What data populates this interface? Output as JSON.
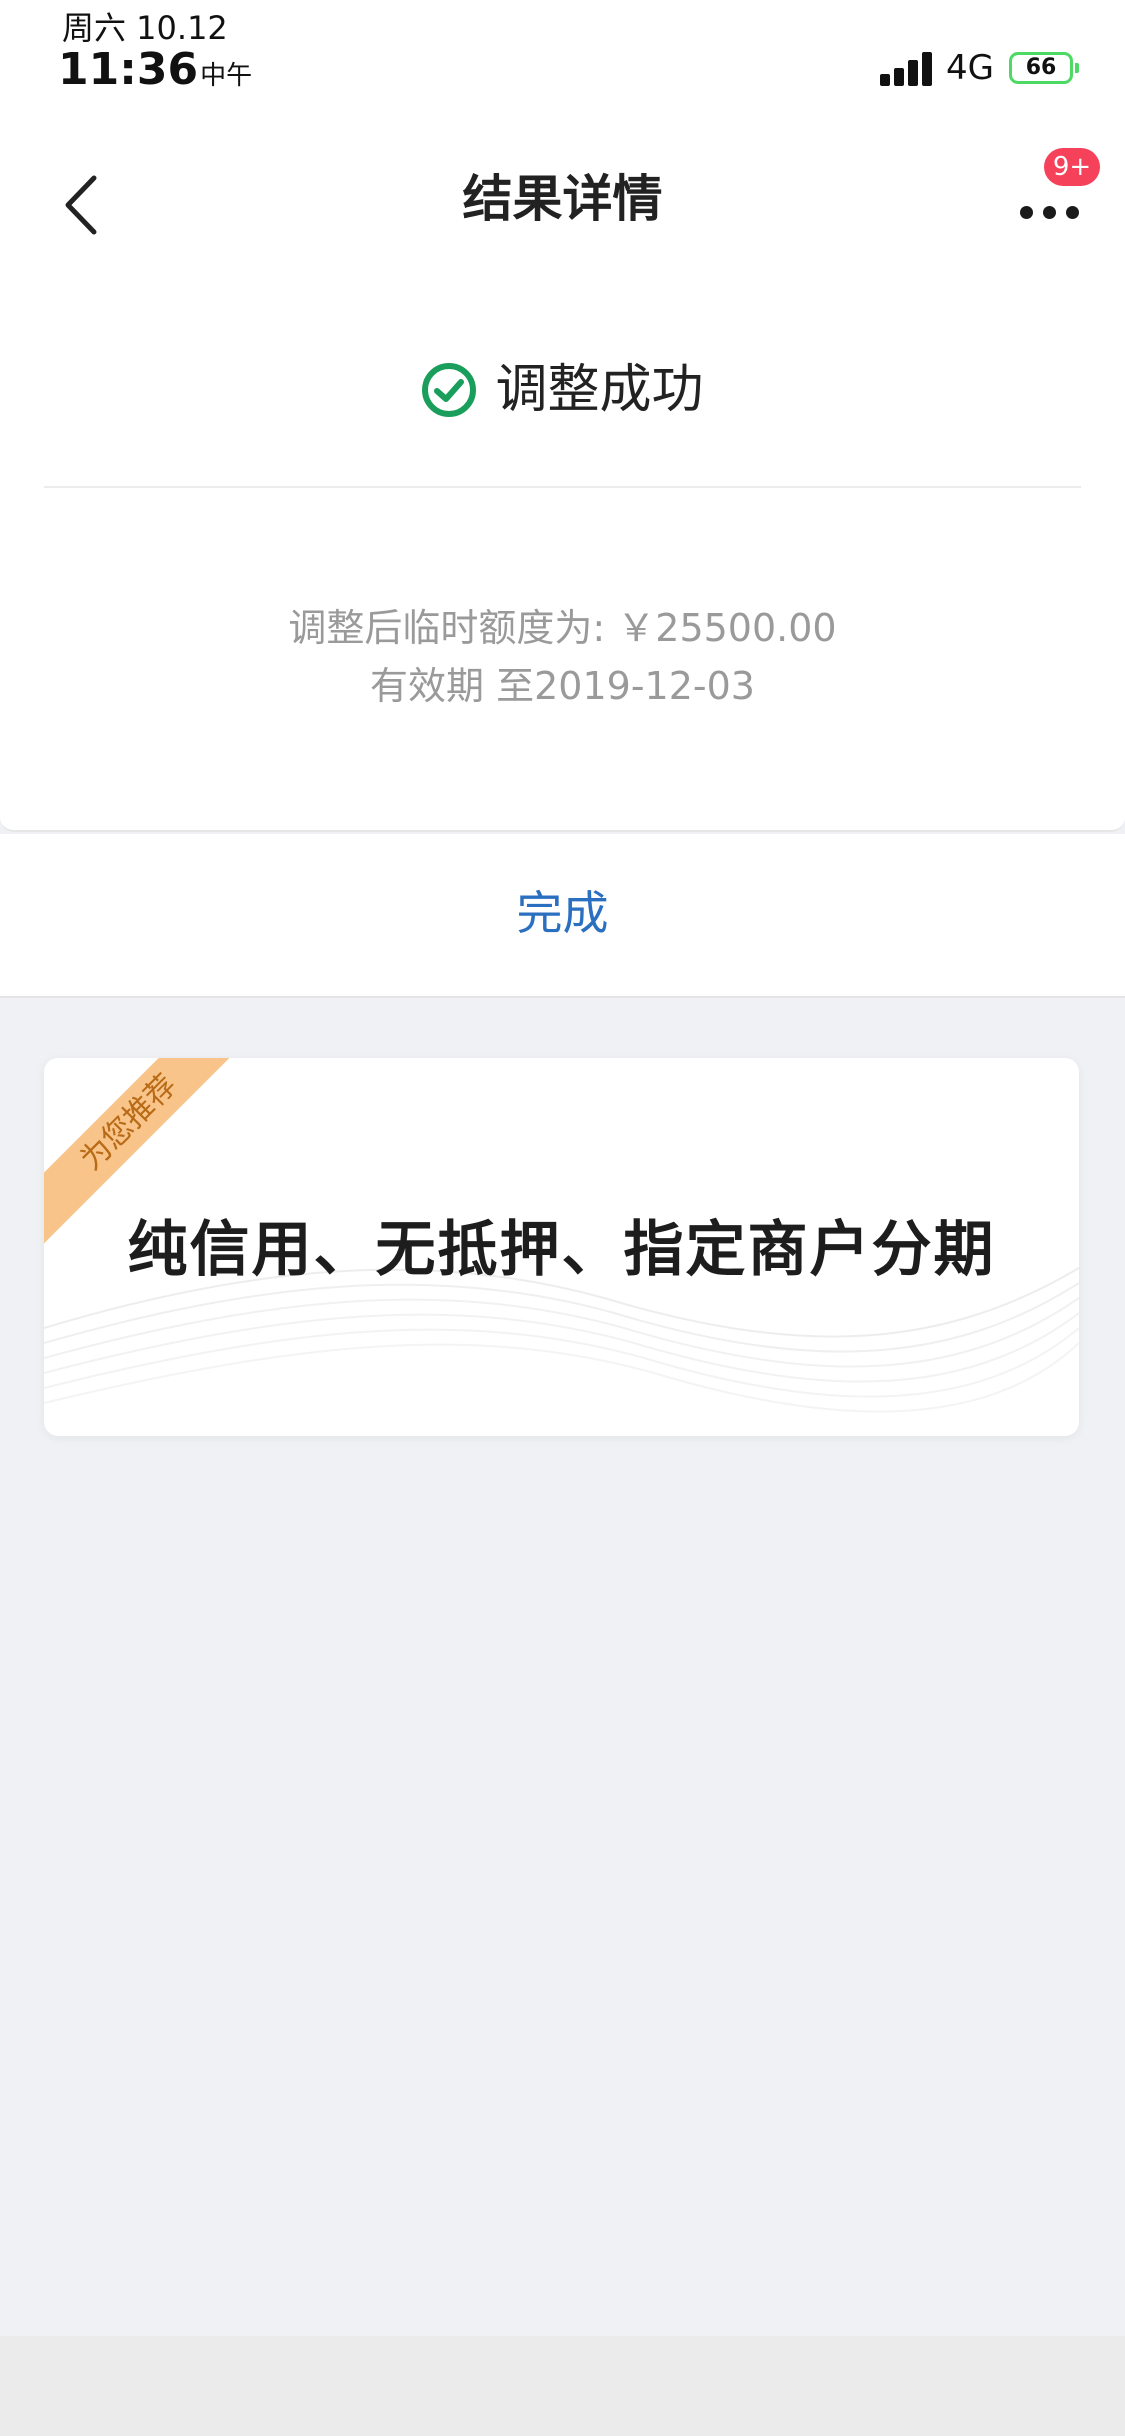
{
  "status_bar": {
    "date": "周六 10.12",
    "time": "11:36",
    "ampm": "中午",
    "network": "4G",
    "battery": "66"
  },
  "nav": {
    "title": "结果详情",
    "badge": "9+"
  },
  "result": {
    "status_text": "调整成功",
    "line1": "调整后临时额度为: ￥25500.00",
    "line2": "有效期 至2019-12-03"
  },
  "actions": {
    "done_label": "完成"
  },
  "promo": {
    "ribbon": "为您推荐",
    "title": "纯信用、无抵押、指定商户分期"
  },
  "colors": {
    "success": "#1a9e5c",
    "link": "#2b6fc0",
    "badge": "#f5415a",
    "ribbon": "#f8c489",
    "battery": "#4cd964"
  }
}
